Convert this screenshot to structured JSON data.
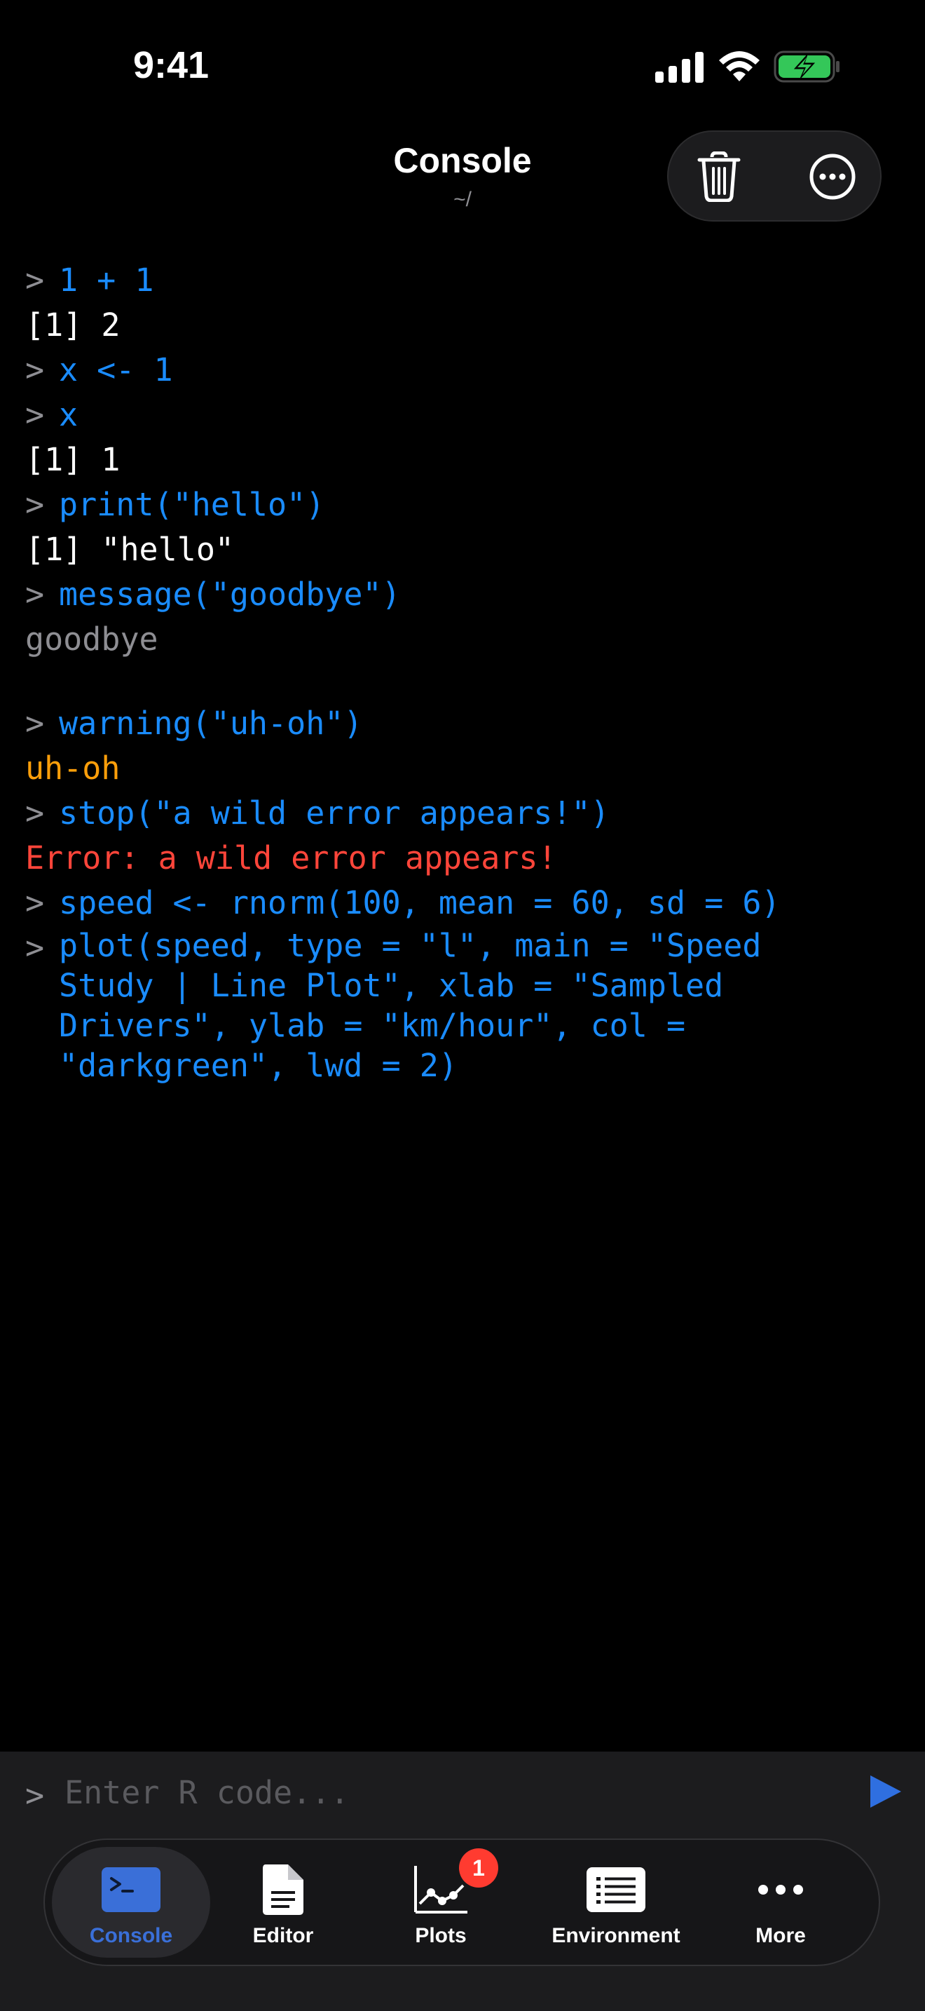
{
  "status_bar": {
    "time": "9:41"
  },
  "header": {
    "title": "Console",
    "subtitle": "~/"
  },
  "header_actions": {
    "trash_icon": "trash-icon",
    "more_icon": "ellipsis-circle-icon"
  },
  "console": {
    "prompt": ">",
    "lines": {
      "l1": "1 + 1",
      "l2": "[1] 2",
      "l3": "x <- 1",
      "l4": "x",
      "l5": "[1] 1",
      "l6": "print(\"hello\")",
      "l7": "[1] \"hello\"",
      "l8": "message(\"goodbye\")",
      "l9": "goodbye",
      "l10": "warning(\"uh-oh\")",
      "l11": "uh-oh",
      "l12": "stop(\"a wild error appears!\")",
      "l13": "Error: a wild error appears!",
      "l14": "speed <- rnorm(100, mean = 60, sd = 6)",
      "l15": "plot(speed, type = \"l\", main = \"Speed Study | Line Plot\", xlab = \"Sampled Drivers\", ylab = \"km/hour\", col = \"darkgreen\", lwd = 2)"
    },
    "colors": {
      "command": "#1a8cff",
      "output": "#ffffff",
      "message": "#8e8e93",
      "warning": "#ff9f0a",
      "error": "#ff453a"
    }
  },
  "input": {
    "prompt": ">",
    "placeholder": "Enter R code...",
    "value": ""
  },
  "tabs": [
    {
      "label": "Console",
      "icon": "terminal-icon",
      "active": true
    },
    {
      "label": "Editor",
      "icon": "document-icon",
      "active": false
    },
    {
      "label": "Plots",
      "icon": "line-chart-icon",
      "active": false,
      "badge": "1"
    },
    {
      "label": "Environment",
      "icon": "list-icon",
      "active": false
    },
    {
      "label": "More",
      "icon": "ellipsis-icon",
      "active": false
    }
  ]
}
